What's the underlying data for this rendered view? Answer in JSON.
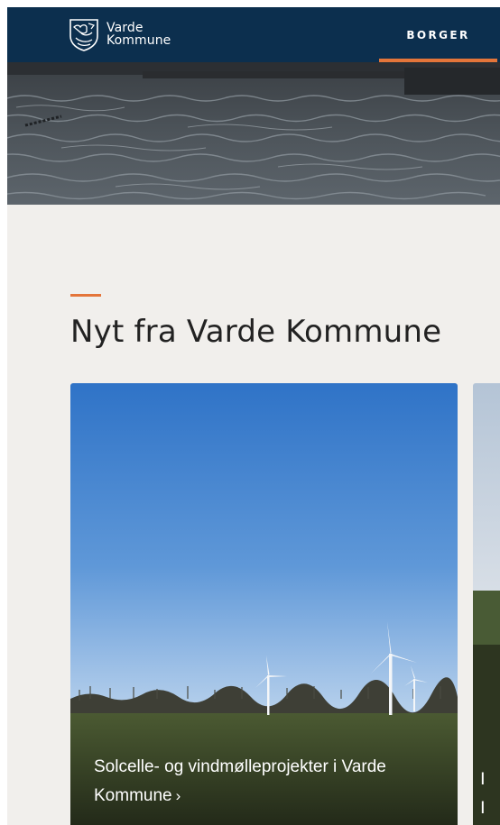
{
  "header": {
    "logo_line1": "Varde",
    "logo_line2": "Kommune",
    "nav_borger": "BORGER"
  },
  "colors": {
    "header_bg": "#0c2f4e",
    "accent": "#e4753a",
    "page_bg": "#f1efec"
  },
  "news": {
    "title": "Nyt fra Varde Kommune",
    "cards": [
      {
        "title": "Solcelle- og vindmølleprojekter i Varde Kommune",
        "chevron": "›"
      },
      {
        "title_fragment_line1": "I",
        "title_fragment_line2": "I"
      }
    ]
  }
}
